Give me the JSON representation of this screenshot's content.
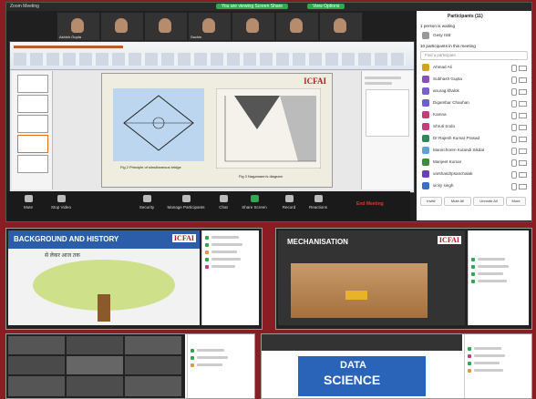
{
  "window": {
    "title": "Zoom Meeting",
    "recording_pill": "You are viewing Screen Share",
    "view_options": "View Options"
  },
  "video_thumbs": [
    {
      "label": "Ashish Gupta"
    },
    {
      "label": ""
    },
    {
      "label": ""
    },
    {
      "label": "Sachin"
    },
    {
      "label": ""
    },
    {
      "label": ""
    },
    {
      "label": ""
    }
  ],
  "slide": {
    "logo": "ICFAI",
    "caption_left": "Fig 2 Principle of simultaneous bridge",
    "caption_right": "Fig 3 Nagamann's diagram"
  },
  "toolbar": {
    "items": [
      "Mute",
      "Stop Video",
      "Security",
      "Manage Participants",
      "Chat",
      "Share Screen",
      "Record",
      "Reactions"
    ],
    "end_label": "End Meeting"
  },
  "participants": {
    "title": "Participants (11)",
    "waiting": "1 person is waiting",
    "waiting_name": "Gesy ISB",
    "in_meeting": "10 participants in this meeting",
    "find_placeholder": "Find a participant",
    "list": [
      {
        "name": "Ahmad Ali",
        "color": "#d4a41a"
      },
      {
        "name": "Subhash Gupta",
        "color": "#8a4fbf"
      },
      {
        "name": "anurag.khalok",
        "color": "#7a5fd1"
      },
      {
        "name": "Digambar Chauhan",
        "color": "#6b5fd1"
      },
      {
        "name": "Kamna",
        "color": "#c43c7a"
      },
      {
        "name": "Shruti Sodo",
        "color": "#c43c7a"
      },
      {
        "name": "Dr Rajesh Kumar Prasad",
        "color": "#2e8b57"
      },
      {
        "name": "Manirchoren Kulandi Sikdar",
        "color": "#5fa3d1"
      },
      {
        "name": "Manjeet Kumar",
        "color": "#3c8c3c"
      },
      {
        "name": "varshasdrpsanchalak",
        "color": "#6a3fbf"
      },
      {
        "name": "vicky singh",
        "color": "#3c6cc4"
      }
    ],
    "buttons": [
      "Invite",
      "Mute All",
      "Unmute All",
      "More"
    ]
  },
  "lower": {
    "background_title": "BACKGROUND AND HISTORY",
    "background_sub": "से लेकर आज तक",
    "mechanisation_title": "MECHANISATION",
    "logo": "ICFAI",
    "data_science": [
      "DATA",
      "SCIENCE"
    ]
  }
}
